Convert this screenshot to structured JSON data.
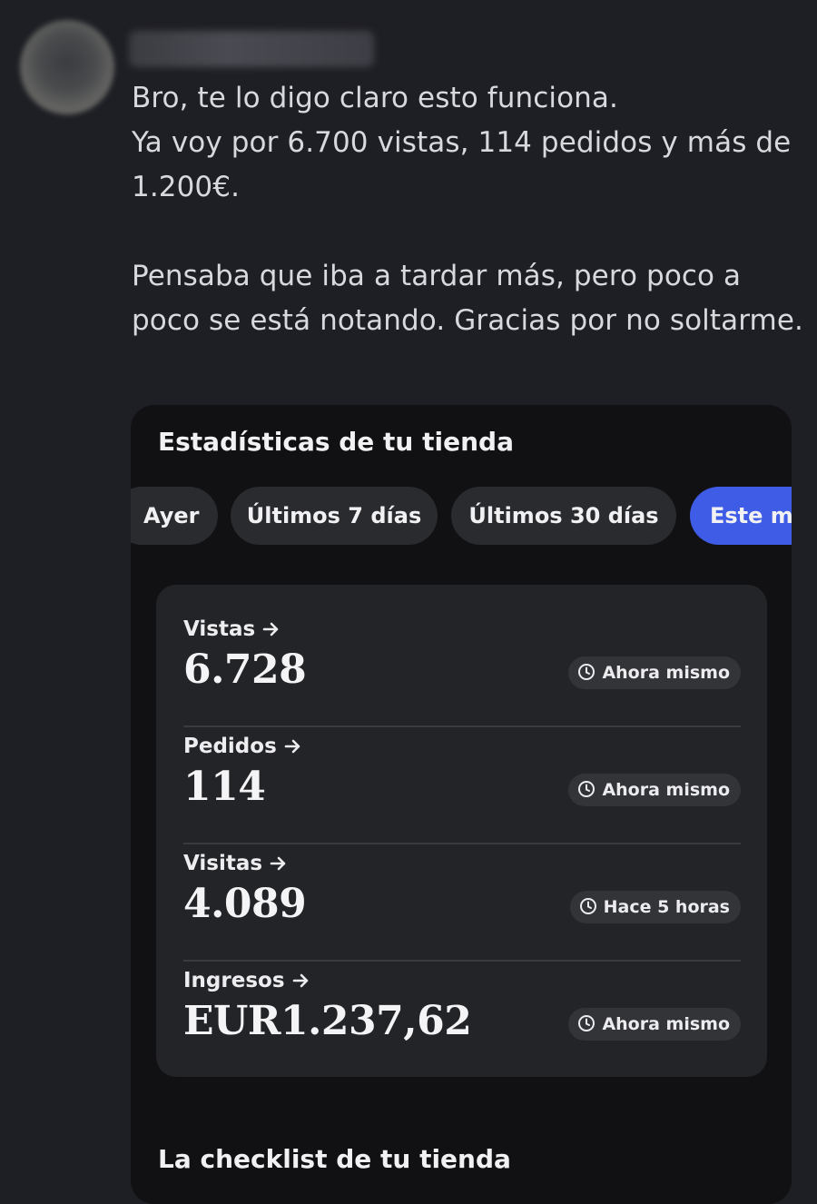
{
  "post": {
    "message_paragraphs": [
      "Bro, te lo digo claro  esto funciona.\nYa voy por 6.700 vistas, 114 pedidos y más de 1.200€.",
      "Pensaba que iba a tardar más, pero poco a poco se está notando. Gracias por no soltarme."
    ]
  },
  "store_stats": {
    "title": "Estadísticas de tu tienda",
    "ranges": [
      {
        "label": "Ayer",
        "selected": false
      },
      {
        "label": "Últimos 7 días",
        "selected": false
      },
      {
        "label": "Últimos 30 días",
        "selected": false
      },
      {
        "label": "Este mes",
        "selected": true
      }
    ],
    "metrics": [
      {
        "label": "Vistas",
        "value": "6.728",
        "updated": "Ahora mismo"
      },
      {
        "label": "Pedidos",
        "value": "114",
        "updated": "Ahora mismo"
      },
      {
        "label": "Visitas",
        "value": "4.089",
        "updated": "Hace 5 horas"
      },
      {
        "label": "Ingresos",
        "value": "EUR1.237,62",
        "updated": "Ahora mismo"
      }
    ]
  },
  "checklist": {
    "title": "La checklist de tu tienda"
  },
  "colors": {
    "page_background": "#1e1f24",
    "card_background": "#111113",
    "stats_background": "#232427",
    "selected_chip": "#3f5ce6"
  },
  "icons": {
    "metric_link": "arrow-right-icon",
    "updated": "clock-icon"
  }
}
